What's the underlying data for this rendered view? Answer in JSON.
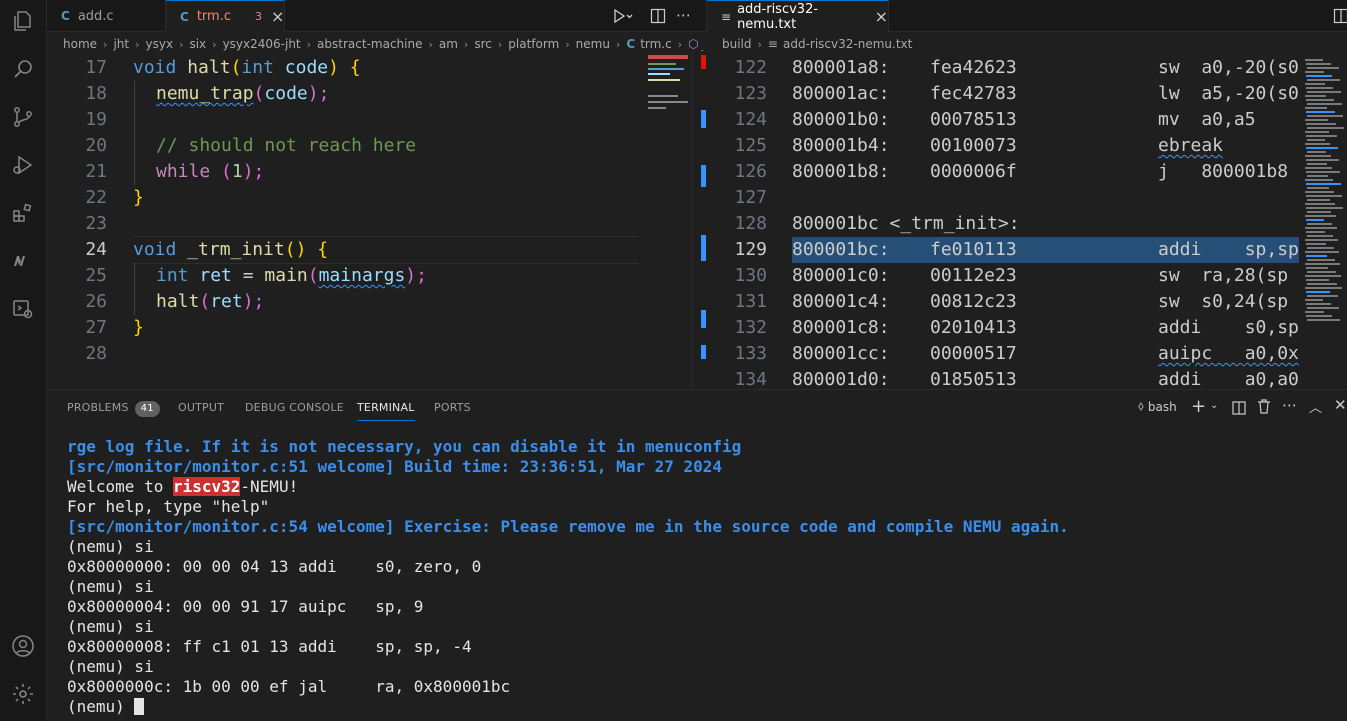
{
  "left_tabs": [
    {
      "icon": "C",
      "label": "add.c"
    },
    {
      "icon": "C",
      "label": "trm.c",
      "problems": "3",
      "close": "×"
    }
  ],
  "right_tab": {
    "icon": "≡",
    "label": "add-riscv32-nemu.txt",
    "close": "×"
  },
  "left_breadcrumb": [
    "home",
    "jht",
    "ysyx",
    "six",
    "ysyx2406-jht",
    "abstract-machine",
    "am",
    "src",
    "platform",
    "nemu",
    "trm.c",
    "_t"
  ],
  "right_breadcrumb": [
    "build",
    "add-riscv32-nemu.txt"
  ],
  "left_code": {
    "lines": [
      {
        "n": "17"
      },
      {
        "n": "18"
      },
      {
        "n": "19"
      },
      {
        "n": "20"
      },
      {
        "n": "21"
      },
      {
        "n": "22"
      },
      {
        "n": "23"
      },
      {
        "n": "24"
      },
      {
        "n": "25"
      },
      {
        "n": "26"
      },
      {
        "n": "27"
      },
      {
        "n": "28"
      }
    ],
    "t17": [
      "void",
      " ",
      "halt",
      "(",
      "int",
      " ",
      "code",
      ")",
      " {"
    ],
    "t18": [
      "nemu_trap",
      "(",
      "code",
      ");"
    ],
    "t20": "// should not reach here",
    "t21": [
      "while",
      " (",
      "1",
      ");"
    ],
    "t22": "}",
    "t24": [
      "void",
      " ",
      "_trm_init",
      "() {"
    ],
    "t25": [
      "int",
      " ",
      "ret",
      " = ",
      "main",
      "(",
      "mainargs",
      ");"
    ],
    "t26": [
      "halt",
      "(",
      "ret",
      ");"
    ],
    "t27": "}"
  },
  "right_code": [
    {
      "n": "122",
      "addr": "800001a8:",
      "hex": "fea42623",
      "asm": "sw  a0,-20(s0"
    },
    {
      "n": "123",
      "addr": "800001ac:",
      "hex": "fec42783",
      "asm": "lw  a5,-20(s0"
    },
    {
      "n": "124",
      "addr": "800001b0:",
      "hex": "00078513",
      "asm": "mv  a0,a5"
    },
    {
      "n": "125",
      "addr": "800001b4:",
      "hex": "00100073",
      "asm": "ebreak"
    },
    {
      "n": "126",
      "addr": "800001b8:",
      "hex": "0000006f",
      "asm": "j   800001b8"
    },
    {
      "n": "127",
      "addr": "",
      "hex": "",
      "asm": ""
    },
    {
      "n": "128",
      "addr": "800001bc <_trm_init>:",
      "hex": "",
      "asm": ""
    },
    {
      "n": "129",
      "addr": "800001bc:",
      "hex": "fe010113",
      "asm": "addi    sp,sp"
    },
    {
      "n": "130",
      "addr": "800001c0:",
      "hex": "00112e23",
      "asm": "sw  ra,28(sp"
    },
    {
      "n": "131",
      "addr": "800001c4:",
      "hex": "00812c23",
      "asm": "sw  s0,24(sp"
    },
    {
      "n": "132",
      "addr": "800001c8:",
      "hex": "02010413",
      "asm": "addi    s0,sp"
    },
    {
      "n": "133",
      "addr": "800001cc:",
      "hex": "00000517",
      "asm": "auipc   a0,0x"
    },
    {
      "n": "134",
      "addr": "800001d0:",
      "hex": "01850513",
      "asm": "addi    a0,a0"
    }
  ],
  "panel": {
    "tabs": [
      "PROBLEMS",
      "OUTPUT",
      "DEBUG CONSOLE",
      "TERMINAL",
      "PORTS"
    ],
    "problems_count": "41",
    "shell": "bash"
  },
  "terminal": {
    "l1": "rge log file. If it is not necessary, you can disable it in menuconfig",
    "l2": "[src/monitor/monitor.c:51 welcome] Build time: 23:36:51, Mar 27 2024",
    "l3a": "Welcome to ",
    "l3b": "riscv32",
    "l3c": "-NEMU!",
    "l4": "For help, type \"help\"",
    "l5": "[src/monitor/monitor.c:54 welcome] Exercise: Please remove me in the source code and compile NEMU again.",
    "l6": "(nemu) si",
    "l7": "0x80000000: 00 00 04 13 addi    s0, zero, 0",
    "l8": "(nemu) si",
    "l9": "0x80000004: 00 00 91 17 auipc   sp, 9",
    "l10": "(nemu) si",
    "l11": "0x80000008: ff c1 01 13 addi    sp, sp, -4",
    "l12": "(nemu) si",
    "l13": "0x8000000c: 1b 00 00 ef jal     ra, 0x800001bc",
    "l14": "(nemu) "
  },
  "colors": {
    "accent": "#0078d4",
    "selection": "#264f78",
    "highlight_red": "#cd3131",
    "terminal_blue": "#3b8eea"
  }
}
